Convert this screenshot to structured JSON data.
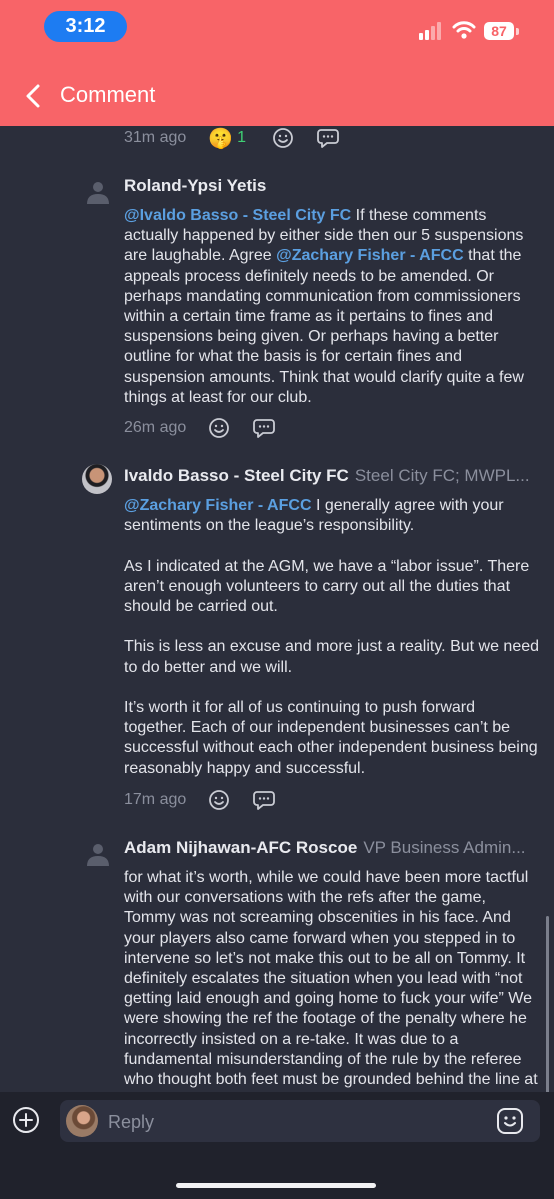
{
  "status_bar": {
    "time": "3:12",
    "battery": "87"
  },
  "nav": {
    "title": "Comment",
    "back_icon": "chevron-left-icon"
  },
  "colors": {
    "header": "#f86468",
    "background": "#2b2e3b",
    "mention": "#5b9fe0",
    "reaction_count": "#3fcf74"
  },
  "top_meta": {
    "time": "31m ago",
    "reaction_emoji": "🤫",
    "reaction_count": "1"
  },
  "comments": [
    {
      "author": "Roland-Ypsi Yetis",
      "role": "",
      "time": "26m ago",
      "paragraphs": [
        {
          "mention1": "@Ivaldo Basso - Steel City FC",
          "text1": " If these comments actually happened by either side then our 5 suspensions are laughable. Agree ",
          "mention2": "@Zachary Fisher - AFCC",
          "text2": " that the appeals process definitely needs to be amended. Or perhaps mandating communication from commissioners within a certain time frame as it pertains to fines and suspensions being given. Or perhaps having a better outline for what the basis is for certain fines and suspension amounts. Think that would clarify quite a few things at least for our club."
        }
      ]
    },
    {
      "author": "Ivaldo Basso - Steel City FC",
      "role": "Steel City FC; MWPL...",
      "time": "17m ago",
      "mention": "@Zachary Fisher - AFCC",
      "paragraphs": [
        " I generally agree with your sentiments on the league’s responsibility.",
        "As I indicated at the AGM, we have a “labor issue”. There aren’t enough volunteers to carry out all the duties that should be carried out.",
        "This is less an excuse and more just a reality. But we need to do better and we will.",
        "It’s worth it for all of us continuing to push forward together. Each of our independent businesses can’t be successful without each other independent business being reasonably happy and successful."
      ]
    },
    {
      "author": "Adam Nijhawan-AFC Roscoe",
      "role": "VP Business Admin...",
      "text": "for what it’s worth, while we could have been more tactful with our conversations with the refs after the game, Tommy was not screaming obscenities in his face. And your players also came forward when you stepped in to intervene so let’s not make this out to be all on Tommy. It definitely escalates the situation when you lead with “not getting laid enough and going home to fuck your wife” We were showing the ref the footage of the penalty where he incorrectly insisted on a re-take. It was due to a fundamental misunderstanding of the rule by the referee who thought both feet must be grounded behind the line at the moment the ball is struck."
    }
  ],
  "composer": {
    "placeholder": "Reply",
    "plus_icon": "plus-circle-icon",
    "emoji_icon": "smiley-icon"
  }
}
